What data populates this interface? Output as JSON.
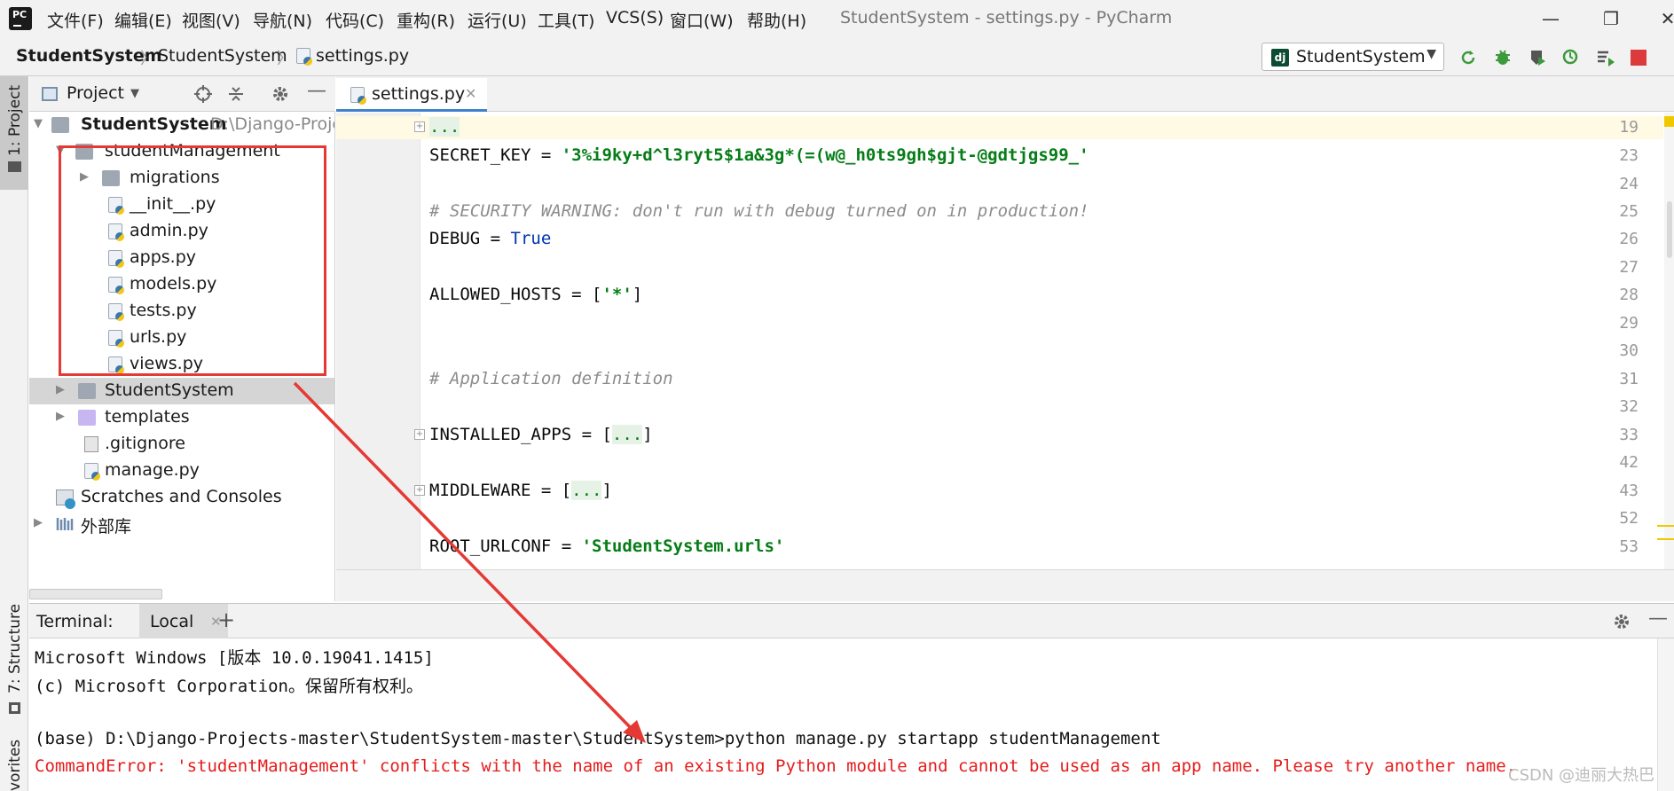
{
  "menubar": {
    "items": [
      "文件(F)",
      "编辑(E)",
      "视图(V)",
      "导航(N)",
      "代码(C)",
      "重构(R)",
      "运行(U)",
      "工具(T)",
      "VCS(S)",
      "窗口(W)",
      "帮助(H)"
    ],
    "window_title": "StudentSystem - settings.py - PyCharm",
    "logo_text": "PC"
  },
  "breadcrumb": {
    "project": "StudentSystem",
    "folder": "StudentSystem",
    "file": "settings.py"
  },
  "run_config": {
    "label": "StudentSystem",
    "badge": "dj"
  },
  "left_strip": {
    "project_tab": "1: Project",
    "structure_tab": "7: Structure",
    "favorites_tab": "vorites"
  },
  "project_panel": {
    "title": "Project",
    "root": {
      "name": "StudentSystem",
      "path": "D:\\Django-Proje"
    },
    "app_folder": "studentManagement",
    "app_children": [
      "migrations",
      "__init__.py",
      "admin.py",
      "apps.py",
      "models.py",
      "tests.py",
      "urls.py",
      "views.py"
    ],
    "others": [
      "StudentSystem",
      "templates",
      ".gitignore",
      "manage.py"
    ],
    "scratches": "Scratches and Consoles",
    "external_libs": "外部库"
  },
  "editor": {
    "tab_label": "settings.py",
    "lines": [
      {
        "num": "19",
        "text": "..."
      },
      {
        "num": "23",
        "text": "SECRET_KEY = '3%i9ky+d^l3ryt5$1a&3g*(=(w@_h0ts9gh$gjt-@gdtjgs99_'"
      },
      {
        "num": "24",
        "text": ""
      },
      {
        "num": "25",
        "text": "# SECURITY WARNING: don't run with debug turned on in production!"
      },
      {
        "num": "26",
        "text": "DEBUG = True"
      },
      {
        "num": "27",
        "text": ""
      },
      {
        "num": "28",
        "text": "ALLOWED_HOSTS = ['*']"
      },
      {
        "num": "29",
        "text": ""
      },
      {
        "num": "30",
        "text": ""
      },
      {
        "num": "31",
        "text": "# Application definition"
      },
      {
        "num": "32",
        "text": ""
      },
      {
        "num": "33",
        "text": "INSTALLED_APPS = [...]"
      },
      {
        "num": "42",
        "text": ""
      },
      {
        "num": "43",
        "text": "MIDDLEWARE = [...]"
      },
      {
        "num": "52",
        "text": ""
      },
      {
        "num": "53",
        "text": "ROOT_URLCONF = 'StudentSystem.urls'"
      }
    ],
    "tokens": {
      "secret_name": "SECRET_KEY = ",
      "secret_value": "'3%i9ky+d^l3ryt5$1a&3g*(=(w@_h0ts9gh$gjt-@gdtjgs99_'",
      "comment_security": "# SECURITY WARNING: don't run with debug turned on in production!",
      "debug_name": "DEBUG = ",
      "debug_value": "True",
      "hosts_name": "ALLOWED_HOSTS = [",
      "hosts_value": "'*'",
      "hosts_end": "]",
      "comment_app": "# Application definition",
      "installed_name": "INSTALLED_APPS = [",
      "installed_fold": "...",
      "installed_end": "]",
      "middleware_name": "MIDDLEWARE = [",
      "middleware_fold": "...",
      "middleware_end": "]",
      "root_name": "ROOT_URLCONF = ",
      "root_value": "'StudentSystem.urls'"
    }
  },
  "terminal": {
    "title": "Terminal:",
    "tab": "Local",
    "lines": [
      "Microsoft Windows [版本 10.0.19041.1415]",
      "(c) Microsoft Corporation。保留所有权利。",
      "",
      "(base) D:\\Django-Projects-master\\StudentSystem-master\\StudentSystem>python manage.py startapp studentManagement"
    ],
    "error": "CommandError: 'studentManagement' conflicts with the name of an existing Python module and cannot be used as an app name. Please try another name."
  },
  "watermark": "CSDN @迪丽大热巴",
  "colors": {
    "annotation": "#e53935",
    "error": "#e51c1c",
    "string": "#067d17",
    "keyword": "#0033b3"
  }
}
